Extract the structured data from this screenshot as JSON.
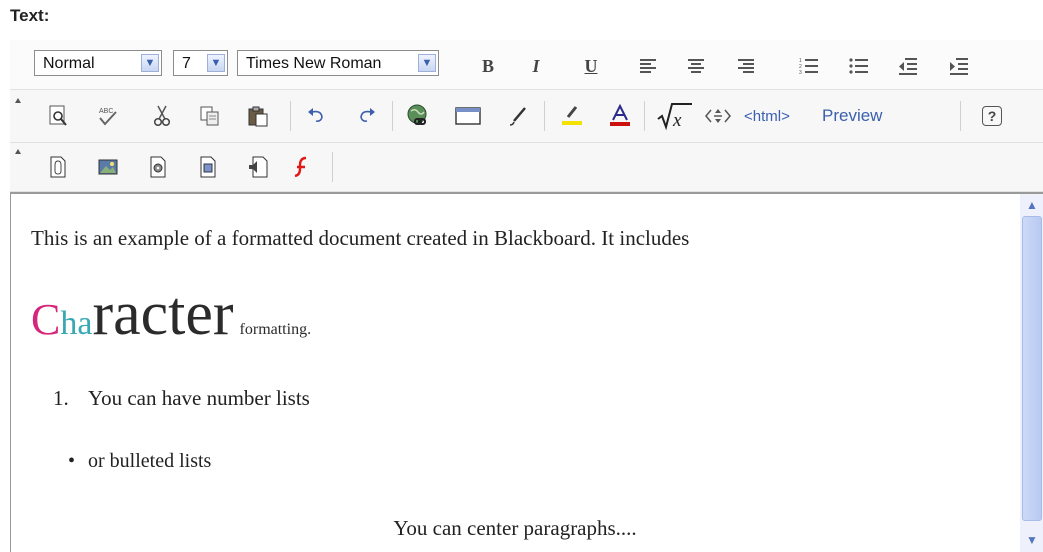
{
  "label": "Text:",
  "toolbar1": {
    "format": "Normal",
    "size": "7",
    "font": "Times New Roman",
    "bold": "B",
    "italic": "I",
    "underline": "U"
  },
  "toolbar2": {
    "html": "<html>",
    "preview": "Preview",
    "help": "?"
  },
  "editor": {
    "line1": "This is an example of a formatted document created in Blackboard. It includes",
    "char_c": "C",
    "char_ha": "ha",
    "char_racter": "racter",
    "formatting": "formatting.",
    "list_number": "1.",
    "list_item": "You can have number lists",
    "bullet": "•",
    "bullet_item": "or bulleted lists",
    "centered": "You can center paragraphs...."
  },
  "colors": {
    "c_color": "#d6267a",
    "ha_color": "#38a8b4",
    "font_color_red": "#cc1111",
    "highlight_yellow": "#f5e100"
  },
  "icons": [
    "dropdown-arrow-icon",
    "bold-icon",
    "italic-icon",
    "underline-icon",
    "align-left-icon",
    "align-center-icon",
    "align-right-icon",
    "ordered-list-icon",
    "unordered-list-icon",
    "outdent-icon",
    "indent-icon",
    "find-icon",
    "spellcheck-icon",
    "cut-icon",
    "copy-icon",
    "paste-icon",
    "undo-icon",
    "redo-icon",
    "link-icon",
    "table-icon",
    "draw-icon",
    "highlight-icon",
    "font-color-icon",
    "equation-icon",
    "code-icon",
    "help-icon",
    "insert-file-icon",
    "insert-image-icon",
    "insert-media-icon",
    "insert-doc-icon",
    "insert-audio-icon",
    "insert-flash-icon"
  ]
}
